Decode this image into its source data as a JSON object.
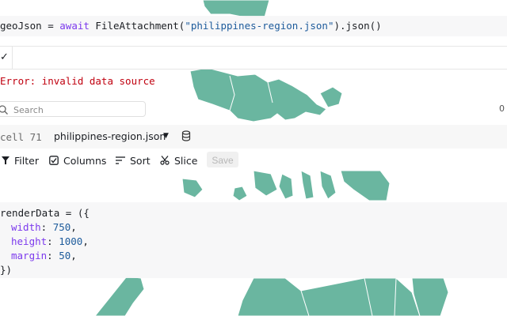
{
  "cells": {
    "geojson": {
      "var": "geoJson",
      "op": " = ",
      "kw": "await",
      "fn": " FileAttachment(",
      "str": "\"philippines-region.json\"",
      "tail": ").json()"
    },
    "output": {
      "check_icon": "check-icon"
    },
    "error": {
      "text": "Error: invalid data source"
    },
    "render_data": {
      "line1": "renderData = ({",
      "width_key": "width",
      "width_val": "750",
      "height_key": "height",
      "height_val": "1000",
      "margin_key": "margin",
      "margin_val": "50",
      "close": "})"
    }
  },
  "table": {
    "search": {
      "placeholder": "Search",
      "value": ""
    },
    "row_count": "0",
    "cell_label": "cell 71",
    "file_name": "philippines-region.json",
    "toolbar": {
      "filter_label": "Filter",
      "columns_label": "Columns",
      "sort_label": "Sort",
      "slice_label": "Slice",
      "save_label": "Save"
    }
  },
  "map": {
    "fill_color": "#6ab6a0",
    "border_color": "#ffffff"
  }
}
